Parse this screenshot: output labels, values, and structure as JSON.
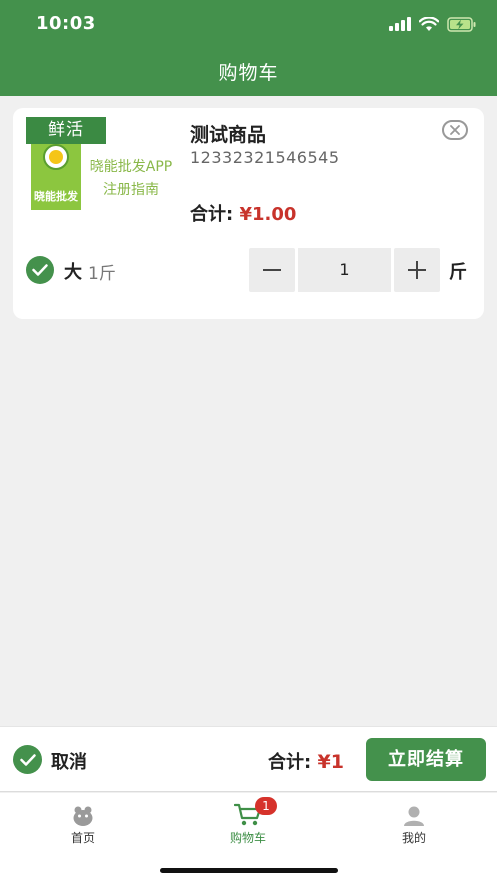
{
  "status_bar": {
    "time": "10:03"
  },
  "header": {
    "title": "购物车"
  },
  "cart_item": {
    "tag": "鲜活",
    "image_text": {
      "line1": "晓能批发APP",
      "line2": "注册指南",
      "logo_text": "晓能批发"
    },
    "name": "测试商品",
    "code": "12332321546545",
    "subtotal_label": "合计:",
    "subtotal_price": "¥1.00",
    "spec_size": "大",
    "spec_unit": "1斤",
    "quantity": "1",
    "unit": "斤"
  },
  "bottom_bar": {
    "cancel_label": "取消",
    "total_label": "合计:",
    "total_price": "¥1",
    "checkout_label": "立即结算"
  },
  "tabs": [
    {
      "label": "首页",
      "icon": "home-icon",
      "active": false
    },
    {
      "label": "购物车",
      "icon": "cart-icon",
      "active": true,
      "badge": "1"
    },
    {
      "label": "我的",
      "icon": "user-icon",
      "active": false
    }
  ],
  "colors": {
    "primary": "#44914c",
    "price": "#c8332b",
    "badge": "#d6322b",
    "background": "#f0f0f0"
  }
}
